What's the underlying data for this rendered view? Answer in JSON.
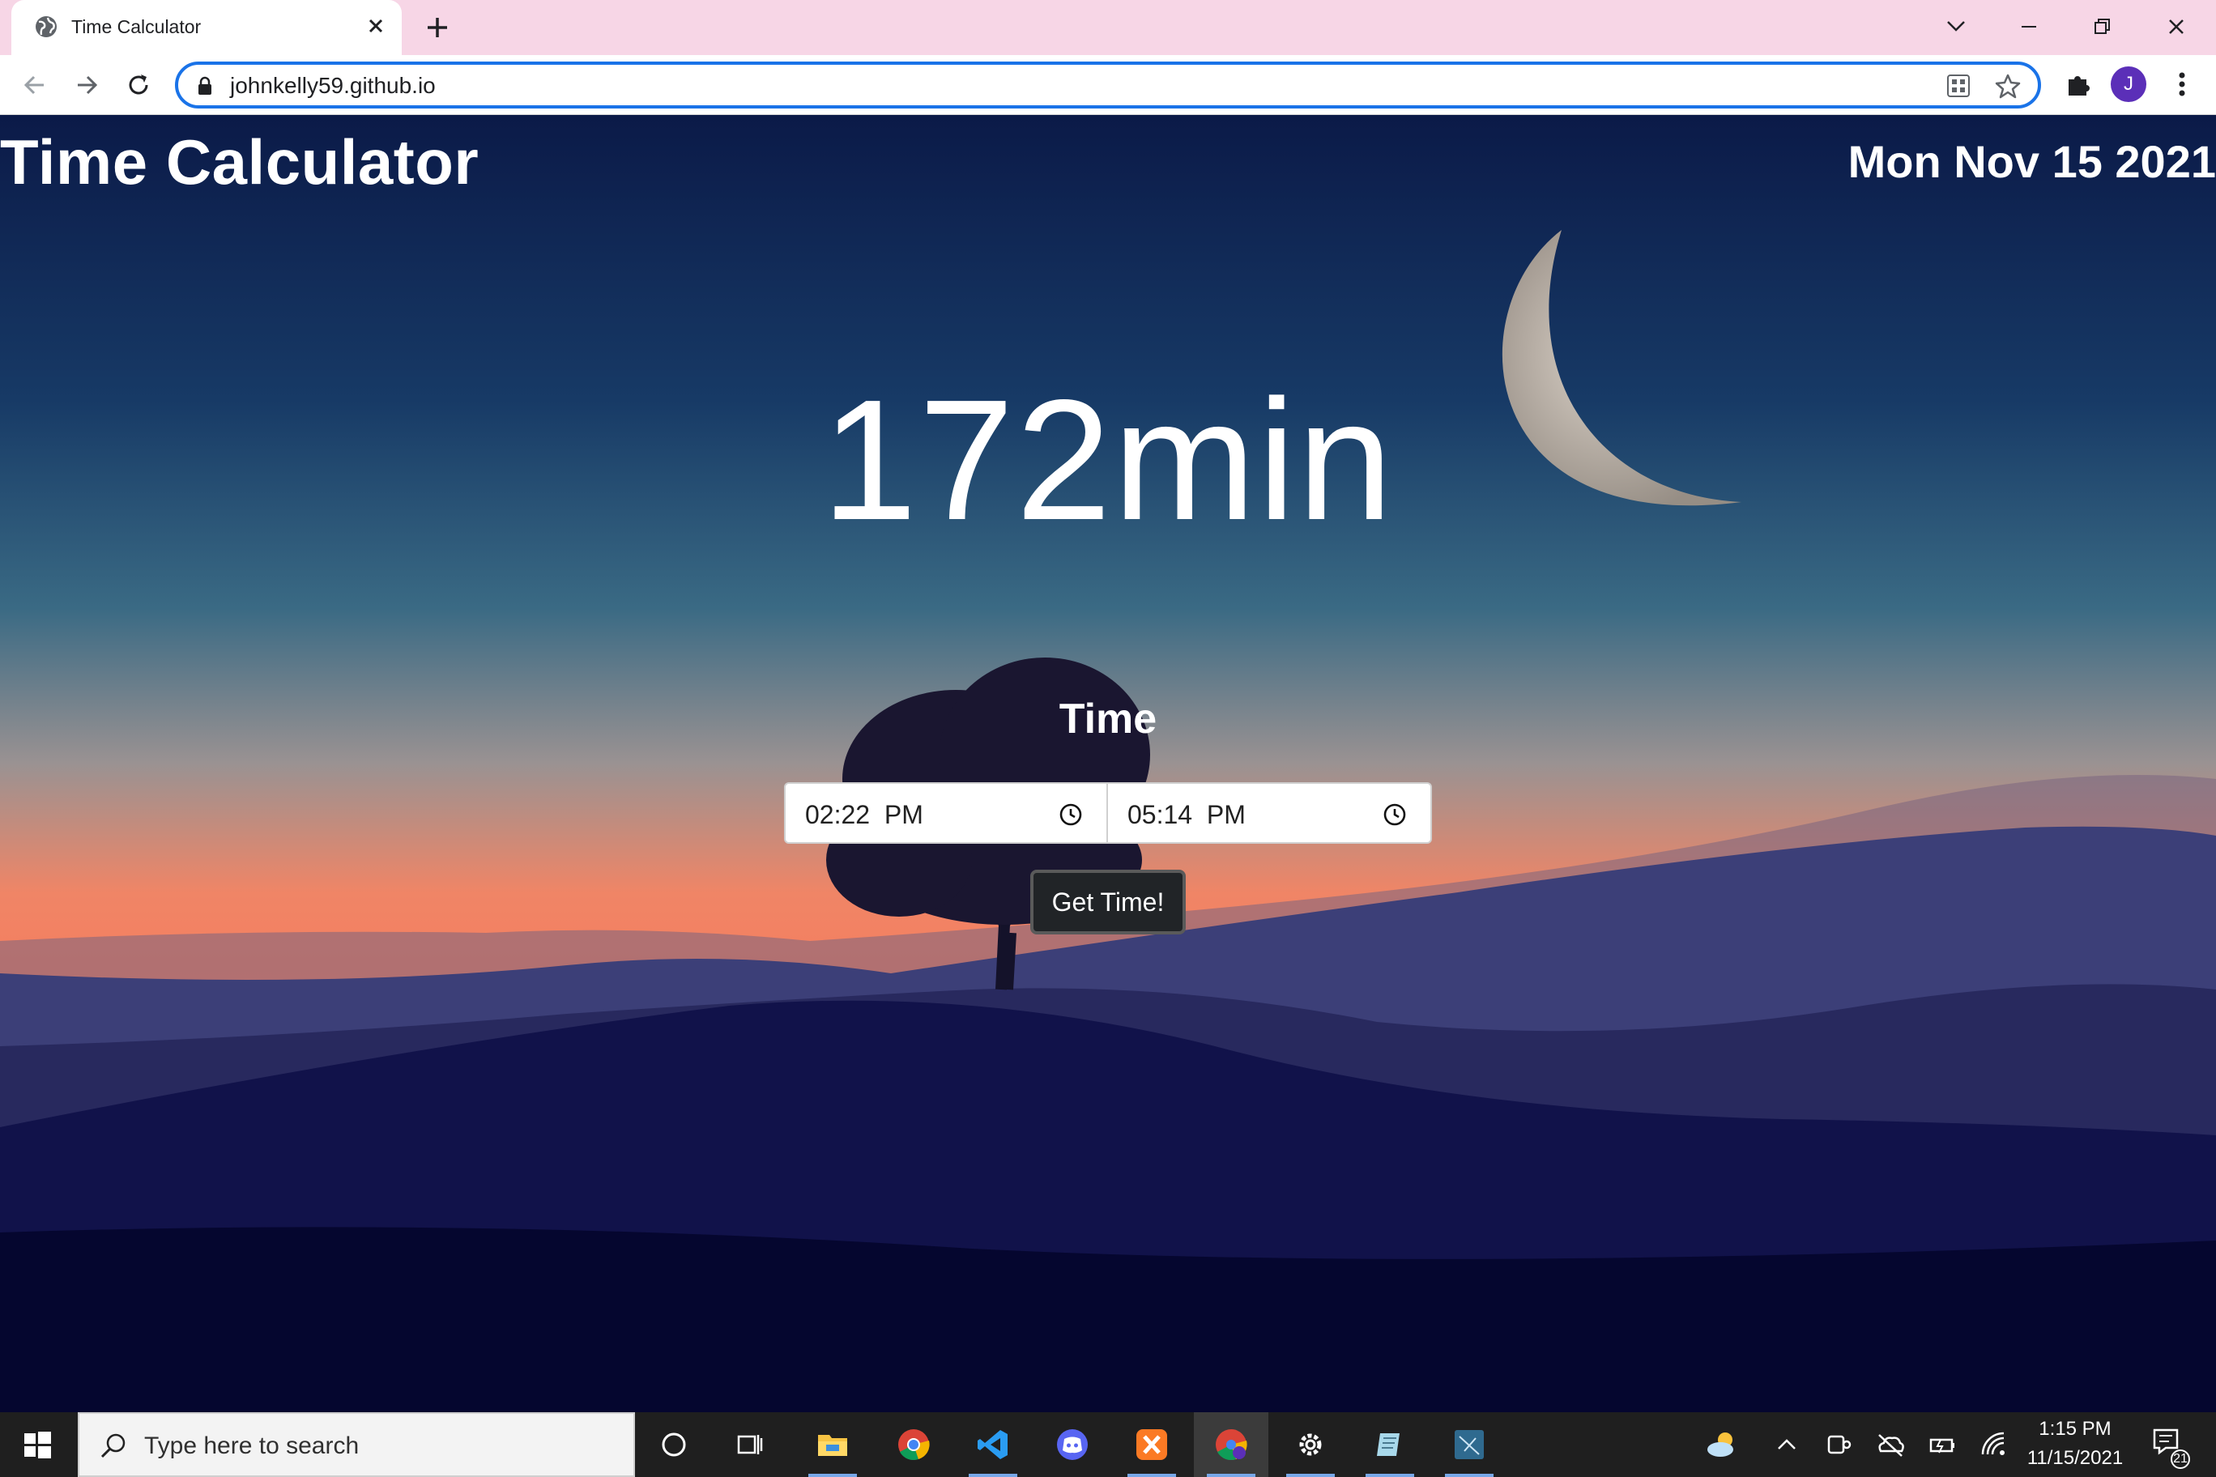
{
  "browser": {
    "tab_title": "Time Calculator",
    "url": "johnkelly59.github.io",
    "avatar_initial": "J",
    "icons": [
      "globe-icon",
      "close-icon",
      "plus-icon",
      "chevron-down-icon",
      "minimize-icon",
      "restore-icon",
      "window-close-icon",
      "back-icon",
      "forward-icon",
      "reload-icon",
      "lock-icon",
      "qr-code-icon",
      "star-icon",
      "puzzle-icon",
      "kebab-menu-icon"
    ]
  },
  "page": {
    "title": "Time Calculator",
    "date": "Mon Nov 15 2021",
    "result": "172min",
    "form_label": "Time",
    "start_time": "02:22  PM",
    "end_time": "05:14  PM",
    "button_label": "Get Time!",
    "colors": {
      "sky_top": "#0c1c4a",
      "sky_mid": "#2f5e7d",
      "horizon": "#f58063",
      "hills": "#2a2f64",
      "foreground": "#050734"
    }
  },
  "taskbar": {
    "search_placeholder": "Type here to search",
    "time": "1:15 PM",
    "date": "11/15/2021",
    "notification_count": "21",
    "apps": [
      "cortana-icon",
      "task-view-icon",
      "file-explorer-icon",
      "chrome-icon",
      "vscode-icon",
      "discord-icon",
      "xampp-icon",
      "chrome-profile-icon",
      "settings-icon",
      "notepad-icon",
      "app-icon"
    ]
  }
}
